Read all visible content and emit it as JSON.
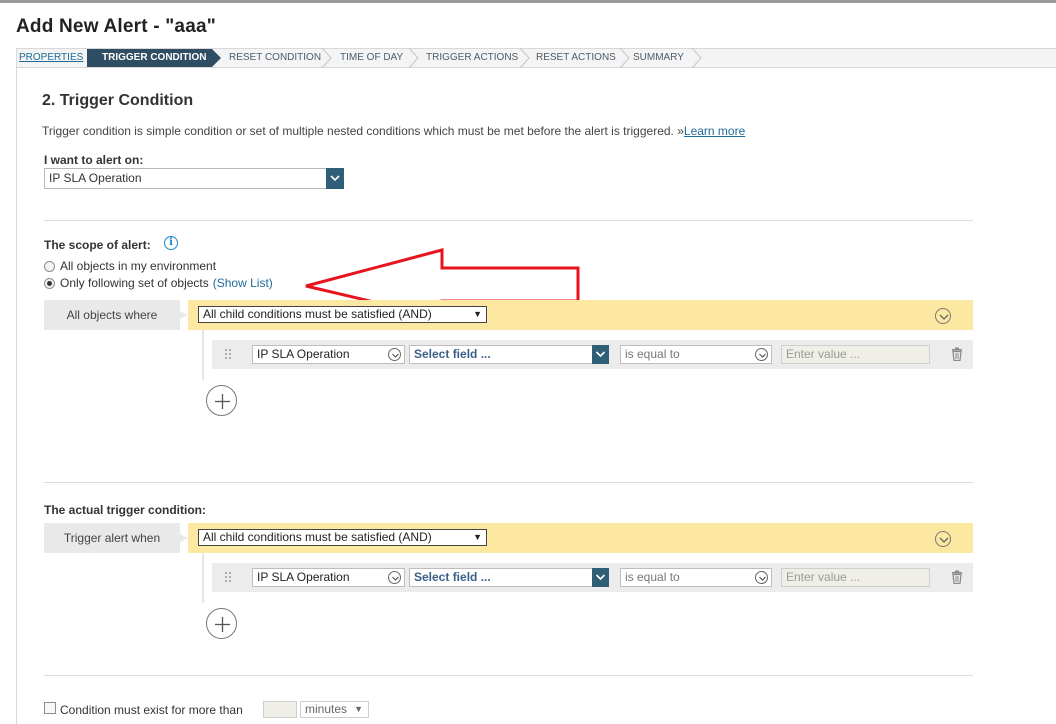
{
  "page": {
    "title": "Add New Alert - \"aaa\""
  },
  "wizard": {
    "steps": [
      "PROPERTIES",
      "TRIGGER CONDITION",
      "RESET CONDITION",
      "TIME OF DAY",
      "TRIGGER ACTIONS",
      "RESET ACTIONS",
      "SUMMARY"
    ],
    "active_step": "TRIGGER CONDITION"
  },
  "section": {
    "title": "2. Trigger Condition",
    "description": "Trigger condition is simple condition or set of multiple nested conditions which must be met before the alert is triggered. »",
    "learn_more": "Learn more"
  },
  "alert_on": {
    "label": "I want to alert on:",
    "value": "IP SLA Operation"
  },
  "scope": {
    "label": "The scope of alert:",
    "option_all": "All objects in my environment",
    "option_following": "Only following set of objects",
    "show_list": "(Show List)",
    "selected": "option_following",
    "where_label": "All objects where",
    "group_condition": "All child conditions must be satisfied (AND)",
    "row": {
      "object": "IP SLA Operation",
      "field": "Select field ...",
      "operator": "is equal to",
      "value_placeholder": "Enter value ..."
    }
  },
  "trigger": {
    "label": "The actual trigger condition:",
    "when_label": "Trigger alert when",
    "group_condition": "All child conditions must be satisfied (AND)",
    "row": {
      "object": "IP SLA Operation",
      "field": "Select field ...",
      "operator": "is equal to",
      "value_placeholder": "Enter value ..."
    }
  },
  "duration": {
    "label": "Condition must exist for more than",
    "unit": "minutes",
    "checked": false
  },
  "colors": {
    "accent": "#2f4d63",
    "highlight_bar": "#fce8a0",
    "annotation_arrow": "#e8141d",
    "link": "#1e6a9a"
  }
}
